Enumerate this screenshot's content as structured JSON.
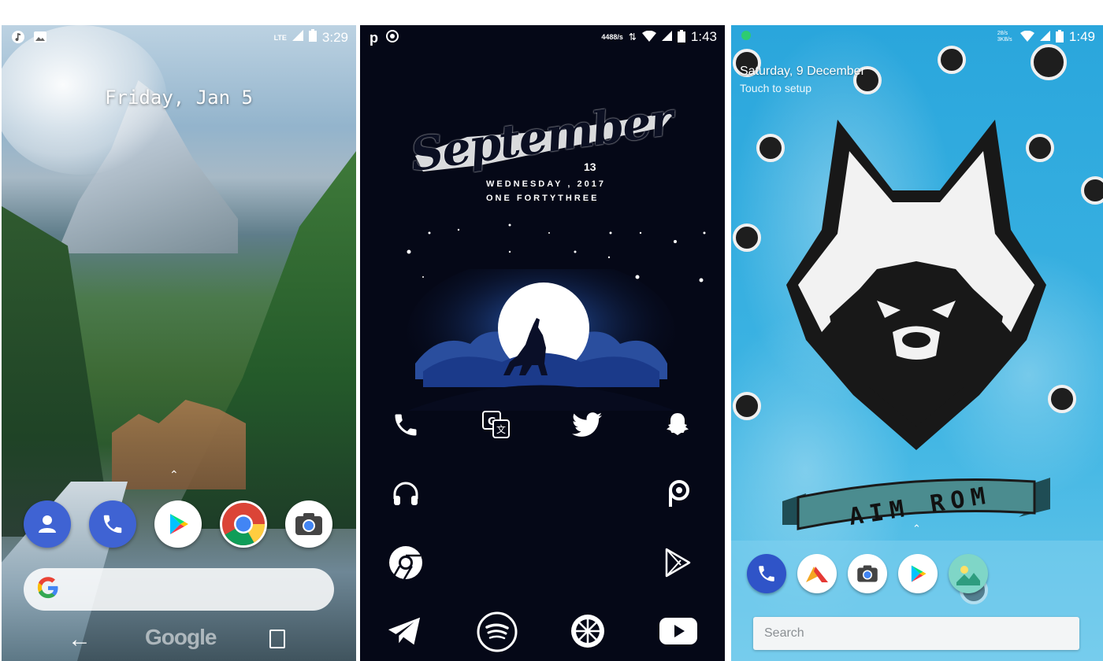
{
  "phone1": {
    "status_time": "3:29",
    "network_label": "LTE",
    "date": "Friday, Jan 5",
    "dock_apps": [
      {
        "name": "Contacts",
        "icon": "contacts-icon",
        "color": "#3f63d3"
      },
      {
        "name": "Phone",
        "icon": "phone-icon",
        "color": "#3f63d3"
      },
      {
        "name": "Play Store",
        "icon": "play-store-icon",
        "color": "#ffffff"
      },
      {
        "name": "Chrome",
        "icon": "chrome-icon",
        "color": "#ffffff"
      },
      {
        "name": "Camera",
        "icon": "camera-icon",
        "color": "#ffffff"
      }
    ],
    "search_logo": "G",
    "nav_brand": "Google"
  },
  "phone2": {
    "status_left_glyph": "p",
    "status_speed": "4488/s",
    "status_time": "1:43",
    "month": "September",
    "day": "13",
    "weekday_line": "WEDNESDAY , 2017",
    "time_words": "ONE  FORTYTHREE",
    "icons": [
      {
        "name": "phone-icon",
        "row": 0,
        "col": 0
      },
      {
        "name": "translate-icon",
        "row": 0,
        "col": 1
      },
      {
        "name": "twitter-icon",
        "row": 0,
        "col": 2
      },
      {
        "name": "snapchat-icon",
        "row": 0,
        "col": 3
      },
      {
        "name": "headphones-icon",
        "row": 1,
        "col": 0
      },
      {
        "name": "picsart-icon",
        "row": 1,
        "col": 3
      },
      {
        "name": "chrome-icon",
        "row": 2,
        "col": 0
      },
      {
        "name": "play-store-icon",
        "row": 2,
        "col": 3
      },
      {
        "name": "telegram-icon",
        "row": 3,
        "col": 0
      },
      {
        "name": "spotify-icon",
        "row": 3,
        "col": 1
      },
      {
        "name": "lemon-icon",
        "row": 3,
        "col": 2
      },
      {
        "name": "youtube-icon",
        "row": 3,
        "col": 3
      }
    ],
    "accent_color": "#2c63c9"
  },
  "phone3": {
    "status_speed": "28/s 3KB/s",
    "status_time": "1:49",
    "date": "Saturday, 9 December",
    "subtitle": "Touch to setup",
    "banner_text": "AIM ROM",
    "dock_apps": [
      {
        "name": "Phone",
        "icon": "phone-icon",
        "color": "#2f54c8"
      },
      {
        "name": "Arrow",
        "icon": "arrow-launcher-icon",
        "color": "#ffffff"
      },
      {
        "name": "Camera",
        "icon": "camera-icon",
        "color": "#ffffff"
      },
      {
        "name": "Play Store",
        "icon": "play-store-icon",
        "color": "#ffffff"
      },
      {
        "name": "Gallery",
        "icon": "gallery-icon",
        "color": "#7fd6c7"
      }
    ],
    "search_placeholder": "Search",
    "background_color": "#3bb0e0"
  }
}
